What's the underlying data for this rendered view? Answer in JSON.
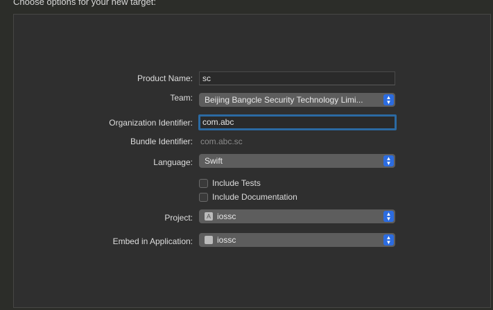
{
  "header": {
    "title": "Choose options for your new target:"
  },
  "form": {
    "product_name": {
      "label": "Product Name:",
      "value": "sc"
    },
    "team": {
      "label": "Team:",
      "value": "Beijing Bangcle Security Technology Limi..."
    },
    "org_id": {
      "label": "Organization Identifier:",
      "value": "com.abc"
    },
    "bundle_id": {
      "label": "Bundle Identifier:",
      "value": "com.abc.sc"
    },
    "language": {
      "label": "Language:",
      "value": "Swift"
    },
    "include_tests": {
      "label": "Include Tests",
      "checked": false
    },
    "include_docs": {
      "label": "Include Documentation",
      "checked": false
    },
    "project": {
      "label": "Project:",
      "value": "iossc"
    },
    "embed": {
      "label": "Embed in Application:",
      "value": "iossc"
    }
  },
  "colors": {
    "accent": "#2c6ce0",
    "focus": "#2b6aa3"
  }
}
